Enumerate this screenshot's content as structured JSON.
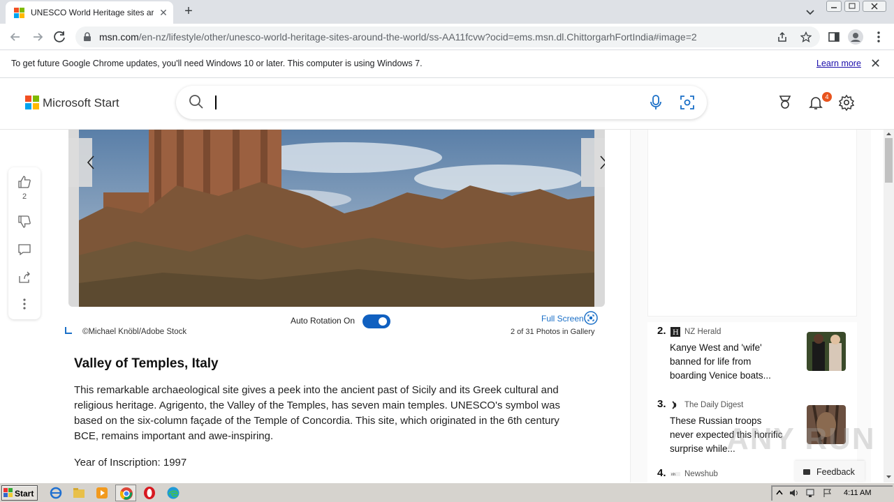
{
  "browser": {
    "tab_title": "UNESCO World Heritage sites around the world",
    "url_host": "msn.com",
    "url_path": "/en-nz/lifestyle/other/unesco-world-heritage-sites-around-the-world/ss-AA11fcvw?ocid=ems.msn.dl.ChittorgarhFortIndia#image=2"
  },
  "infobar": {
    "message": "To get future Google Chrome updates, you'll need Windows 10 or later. This computer is using Windows 7.",
    "learn_more": "Learn more"
  },
  "header": {
    "brand": "Microsoft Start",
    "notification_count": "4"
  },
  "rail": {
    "like_count": "2"
  },
  "gallery": {
    "auto_rotation_label": "Auto Rotation On",
    "auto_rotation_on": true,
    "full_screen_label": "Full Screen",
    "credit": "©Michael Knöbl/Adobe Stock",
    "count_text": "2 of 31 Photos in Gallery"
  },
  "article": {
    "title": "Valley of Temples, Italy",
    "body": "This remarkable archaeological site gives a peek into the ancient past of Sicily and its Greek cultural and religious heritage. Agrigento, the Valley of the Temples, has seven main temples. UNESCO's symbol was based on the six-column façade of the Temple of Concordia. This site, which originated in the 6th century BCE, remains important and awe-inspiring.",
    "year": "Year of Inscription: 1997"
  },
  "news": [
    {
      "num": "2.",
      "source": "NZ Herald",
      "title": "Kanye West and 'wife' banned for life from boarding Venice boats..."
    },
    {
      "num": "3.",
      "source": "The Daily Digest",
      "title": "These Russian troops never expected this horrific surprise while..."
    },
    {
      "num": "4.",
      "source": "Newshub",
      "title": ""
    }
  ],
  "feedback_label": "Feedback",
  "taskbar": {
    "start_label": "Start",
    "clock": "4:11 AM"
  },
  "watermark": "ANY RUN",
  "colors": {
    "accent": "#1060c0",
    "badge": "#e8541e",
    "link": "#1a6fc7"
  }
}
